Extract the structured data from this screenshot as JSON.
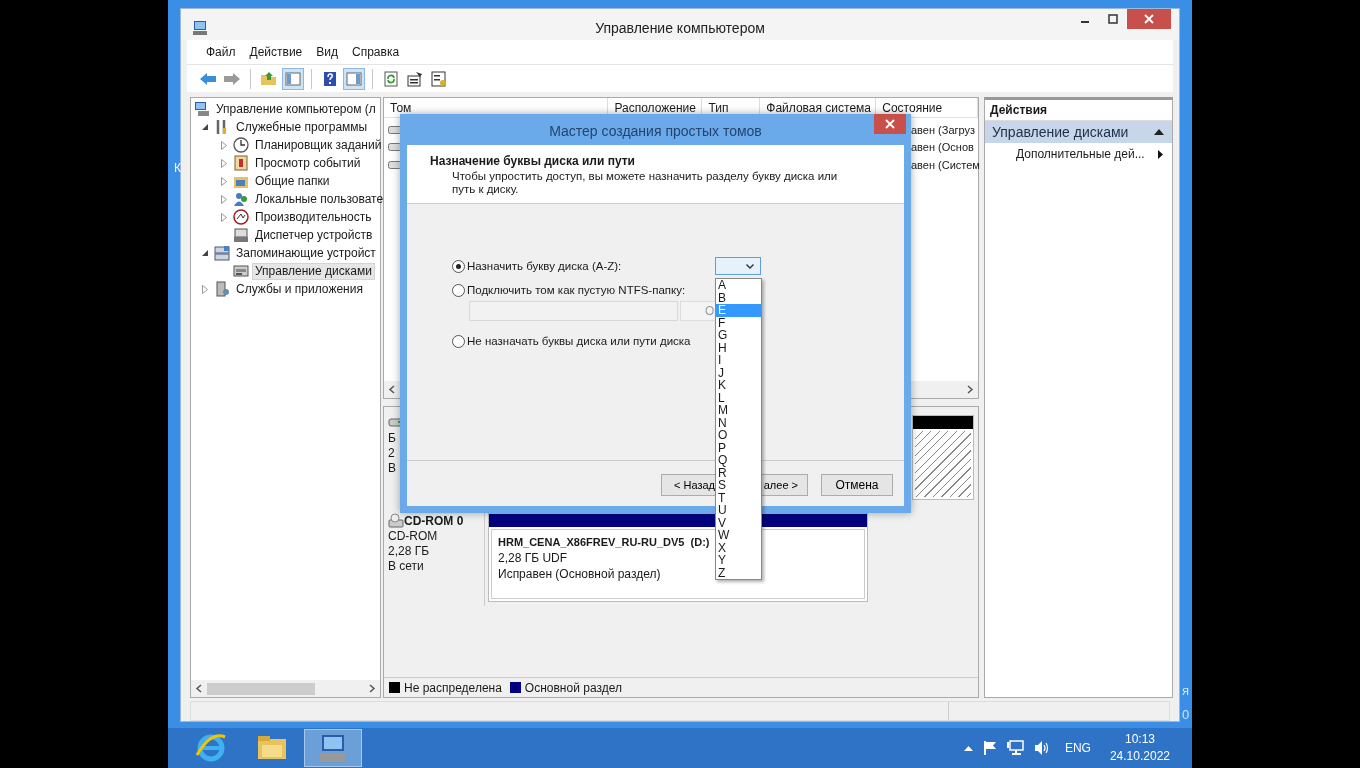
{
  "desktop": {
    "left_text": "К",
    "right_text": [
      "я",
      "0"
    ]
  },
  "window": {
    "title": "Управление компьютером"
  },
  "menu": [
    {
      "label": "Файл"
    },
    {
      "label": "Действие"
    },
    {
      "label": "Вид"
    },
    {
      "label": "Справка"
    }
  ],
  "toolbar": [
    {
      "kind": "back",
      "pressed": false
    },
    {
      "kind": "forward",
      "pressed": false
    },
    {
      "kind": "separator"
    },
    {
      "kind": "up",
      "pressed": false
    },
    {
      "kind": "tree_toggle",
      "pressed": true
    },
    {
      "kind": "separator"
    },
    {
      "kind": "help",
      "pressed": false
    },
    {
      "kind": "pane_toggle",
      "pressed": true
    },
    {
      "kind": "separator"
    },
    {
      "kind": "refresh",
      "pressed": false
    },
    {
      "kind": "properties",
      "pressed": false
    },
    {
      "kind": "export",
      "pressed": false
    }
  ],
  "tree": [
    {
      "label": "Управление компьютером (л",
      "selected": false,
      "children": [
        {
          "label": "Служебные программы",
          "expanded": true,
          "selected": false,
          "children": [
            {
              "label": "Планировщик заданий",
              "expanded": false,
              "selected": false
            },
            {
              "label": "Просмотр событий",
              "expanded": false,
              "selected": false
            },
            {
              "label": "Общие папки",
              "expanded": false,
              "selected": false
            },
            {
              "label": "Локальные пользовате",
              "expanded": false,
              "selected": false
            },
            {
              "label": "Производительность",
              "expanded": false,
              "selected": false
            },
            {
              "label": "Диспетчер устройств",
              "selected": false
            }
          ]
        },
        {
          "label": "Запоминающие устройст",
          "expanded": true,
          "selected": false,
          "children": [
            {
              "label": "Управление дисками",
              "selected": true
            }
          ]
        },
        {
          "label": "Службы и приложения",
          "expanded": false,
          "selected": false
        }
      ]
    }
  ],
  "volumes": {
    "columns": [
      "Том",
      "Расположение",
      "Тип",
      "Файловая система",
      "Состояние"
    ],
    "rows": [
      {
        "status": "авен (Загруз"
      },
      {
        "status": "авен (Основ"
      },
      {
        "status": "авен (Систем"
      }
    ]
  },
  "disks": [
    {
      "kind": "disk",
      "lines": [
        "Б",
        "2",
        "В"
      ],
      "partitions": [
        {
          "kind": "unallocated"
        }
      ]
    },
    {
      "kind": "cdrom",
      "name": "CD-ROM 0",
      "lines": [
        "CD-ROM",
        "2,28 ГБ",
        "В сети"
      ],
      "partitions": [
        {
          "kind": "primary",
          "title": "HRM_CENA_X86FREV_RU-RU_DV5  (D:)",
          "lines": [
            "2,28 ГБ UDF",
            "Исправен (Основной раздел)"
          ]
        }
      ]
    }
  ],
  "legend": [
    {
      "label": "Не распределена",
      "color": "#000000"
    },
    {
      "label": "Основной раздел",
      "color": "#000080"
    }
  ],
  "actions": {
    "title": "Действия",
    "section": {
      "label": "Управление дисками",
      "expanded": true
    },
    "items": [
      {
        "label": "Дополнительные дей..."
      }
    ]
  },
  "dialog": {
    "title": "Мастер создания простых томов",
    "heading": "Назначение буквы диска или пути",
    "description": "Чтобы упростить доступ, вы можете назначить разделу букву диска или путь к диску.",
    "options": [
      {
        "label": "Назначить букву диска (A-Z):",
        "selected": true
      },
      {
        "label": "Подключить том как пустую NTFS-папку:",
        "selected": false
      },
      {
        "label": "Не назначать буквы диска или пути диска",
        "selected": false
      }
    ],
    "folder_field": {
      "disabled": true
    },
    "browse_button": {
      "label": "О",
      "disabled": true
    },
    "letter_combo": {
      "expanded": true,
      "letters": [
        {
          "label": "A",
          "selected": false
        },
        {
          "label": "B",
          "selected": false
        },
        {
          "label": "E",
          "selected": true
        },
        {
          "label": "F",
          "selected": false
        },
        {
          "label": "G",
          "selected": false
        },
        {
          "label": "H",
          "selected": false
        },
        {
          "label": "I",
          "selected": false
        },
        {
          "label": "J",
          "selected": false
        },
        {
          "label": "K",
          "selected": false
        },
        {
          "label": "L",
          "selected": false
        },
        {
          "label": "M",
          "selected": false
        },
        {
          "label": "N",
          "selected": false
        },
        {
          "label": "O",
          "selected": false
        },
        {
          "label": "P",
          "selected": false
        },
        {
          "label": "Q",
          "selected": false
        },
        {
          "label": "R",
          "selected": false
        },
        {
          "label": "S",
          "selected": false
        },
        {
          "label": "T",
          "selected": false
        },
        {
          "label": "U",
          "selected": false
        },
        {
          "label": "V",
          "selected": false
        },
        {
          "label": "W",
          "selected": false
        },
        {
          "label": "X",
          "selected": false
        },
        {
          "label": "Y",
          "selected": false
        },
        {
          "label": "Z",
          "selected": false
        }
      ]
    },
    "buttons": [
      {
        "kind": "back",
        "label": "< Назад"
      },
      {
        "kind": "next",
        "label": "алее >"
      },
      {
        "kind": "cancel",
        "label": "Отмена"
      }
    ]
  },
  "taskbar": {
    "apps": [
      {
        "kind": "browser",
        "active": false
      },
      {
        "kind": "files",
        "active": false
      },
      {
        "kind": "console",
        "active": true
      }
    ],
    "language": "ENG",
    "time": "10:13",
    "date": "24.10.2022"
  }
}
